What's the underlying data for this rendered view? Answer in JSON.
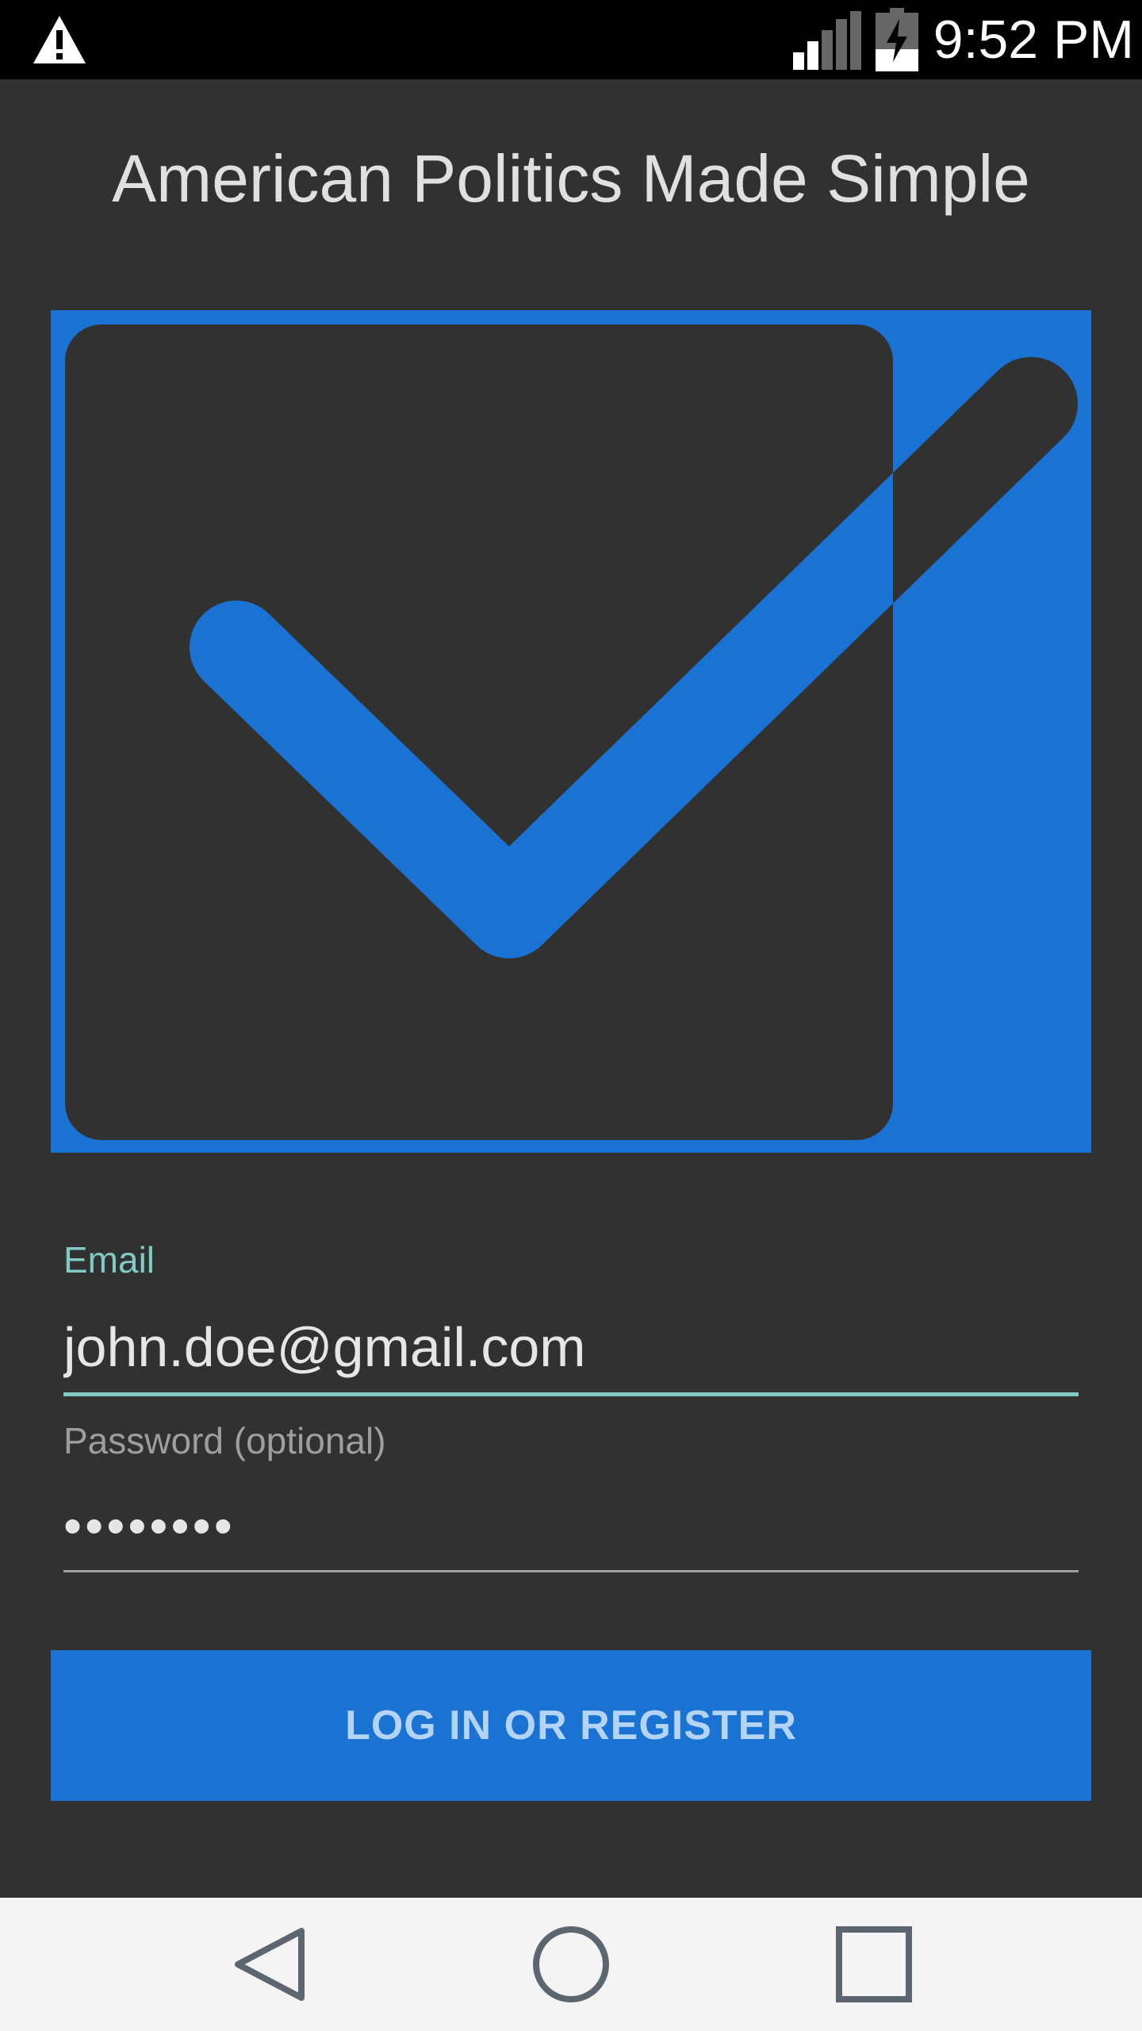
{
  "status_bar": {
    "time": "9:52 PM",
    "icons": [
      "warning-icon",
      "signal-icon",
      "battery-charging-icon"
    ]
  },
  "app": {
    "title": "American Politics Made Simple"
  },
  "logo": {
    "icon": "checkbox-checked-icon",
    "colors": {
      "accent": "#1a73d2",
      "background": "#313131"
    }
  },
  "form": {
    "email_label": "Email",
    "email_value": "john.doe@gmail.com",
    "password_label": "Password (optional)",
    "password_value": "********",
    "submit_label": "LOG IN OR REGISTER"
  },
  "colors": {
    "primary": "#1a73d2",
    "focus_accent": "#80cbc4",
    "surface": "#313131",
    "nav_bar": "#f4f4f4"
  },
  "nav_bar": {
    "icons": [
      "back-icon",
      "home-icon",
      "recent-apps-icon"
    ]
  }
}
